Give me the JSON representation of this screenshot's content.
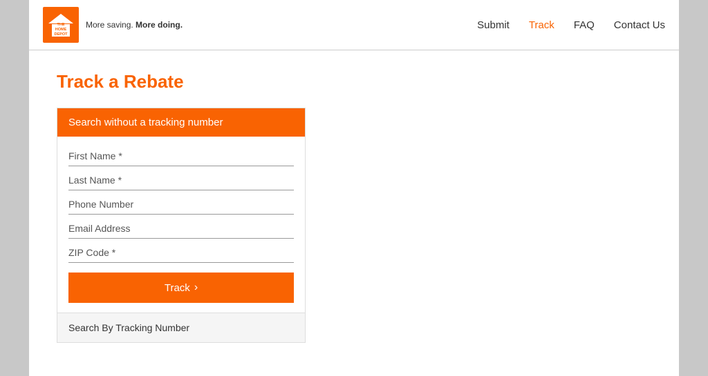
{
  "header": {
    "logo": {
      "line1": "THE",
      "line2": "HOME",
      "line3": "DEPOT"
    },
    "tagline": "More saving. More doing.",
    "nav": {
      "submit": "Submit",
      "track": "Track",
      "faq": "FAQ",
      "contact": "Contact Us"
    }
  },
  "main": {
    "page_title": "Track a Rebate",
    "form": {
      "section_header": "Search without a tracking number",
      "fields": {
        "first_name_placeholder": "First Name *",
        "last_name_placeholder": "Last Name *",
        "phone_placeholder": "Phone Number",
        "email_placeholder": "Email Address",
        "zip_placeholder": "ZIP Code *"
      },
      "track_button": "Track",
      "track_arrow": "›",
      "footer_link": "Search By Tracking Number"
    }
  }
}
